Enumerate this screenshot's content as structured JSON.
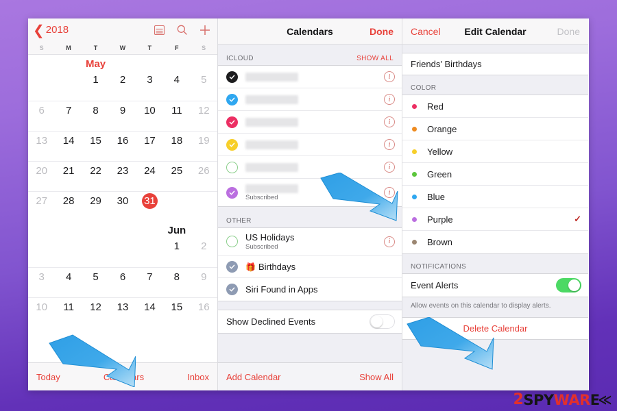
{
  "watermark": {
    "part1": "2",
    "part2": "SPY",
    "part3": "WAR",
    "part4": "E",
    "chevron": "≪"
  },
  "calendar_panel": {
    "back_label": "2018",
    "back_icon": "chevron-left-icon",
    "tools": [
      "list-view-icon",
      "search-icon",
      "add-icon"
    ],
    "weekdays": [
      "S",
      "M",
      "T",
      "W",
      "T",
      "F",
      "S"
    ],
    "months": [
      {
        "name": "May",
        "is_current": true,
        "weeks": [
          [
            {
              "num": "",
              "dot": false,
              "weekend": false,
              "today": false
            },
            {
              "num": "",
              "dot": false,
              "weekend": false,
              "today": false
            },
            {
              "num": "1",
              "dot": true,
              "weekend": false,
              "today": false
            },
            {
              "num": "2",
              "dot": true,
              "weekend": false,
              "today": false
            },
            {
              "num": "3",
              "dot": true,
              "weekend": false,
              "today": false
            },
            {
              "num": "4",
              "dot": true,
              "weekend": false,
              "today": false
            },
            {
              "num": "5",
              "dot": true,
              "weekend": true,
              "today": false
            }
          ],
          [
            {
              "num": "6",
              "dot": true,
              "weekend": true,
              "today": false
            },
            {
              "num": "7",
              "dot": true,
              "weekend": false,
              "today": false
            },
            {
              "num": "8",
              "dot": true,
              "weekend": false,
              "today": false
            },
            {
              "num": "9",
              "dot": true,
              "weekend": false,
              "today": false
            },
            {
              "num": "10",
              "dot": true,
              "weekend": false,
              "today": false
            },
            {
              "num": "11",
              "dot": true,
              "weekend": false,
              "today": false
            },
            {
              "num": "12",
              "dot": true,
              "weekend": true,
              "today": false
            }
          ],
          [
            {
              "num": "13",
              "dot": true,
              "weekend": true,
              "today": false
            },
            {
              "num": "14",
              "dot": true,
              "weekend": false,
              "today": false
            },
            {
              "num": "15",
              "dot": true,
              "weekend": false,
              "today": false
            },
            {
              "num": "16",
              "dot": true,
              "weekend": false,
              "today": false
            },
            {
              "num": "17",
              "dot": true,
              "weekend": false,
              "today": false
            },
            {
              "num": "18",
              "dot": true,
              "weekend": false,
              "today": false
            },
            {
              "num": "19",
              "dot": true,
              "weekend": true,
              "today": false
            }
          ],
          [
            {
              "num": "20",
              "dot": true,
              "weekend": true,
              "today": false
            },
            {
              "num": "21",
              "dot": true,
              "weekend": false,
              "today": false
            },
            {
              "num": "22",
              "dot": true,
              "weekend": false,
              "today": false
            },
            {
              "num": "23",
              "dot": true,
              "weekend": false,
              "today": false
            },
            {
              "num": "24",
              "dot": true,
              "weekend": false,
              "today": false
            },
            {
              "num": "25",
              "dot": true,
              "weekend": false,
              "today": false
            },
            {
              "num": "26",
              "dot": true,
              "weekend": true,
              "today": false
            }
          ],
          [
            {
              "num": "27",
              "dot": true,
              "weekend": true,
              "today": false
            },
            {
              "num": "28",
              "dot": true,
              "weekend": false,
              "today": false
            },
            {
              "num": "29",
              "dot": true,
              "weekend": false,
              "today": false
            },
            {
              "num": "30",
              "dot": true,
              "weekend": false,
              "today": false
            },
            {
              "num": "31",
              "dot": false,
              "weekend": false,
              "today": true
            },
            {
              "num": "",
              "dot": false,
              "weekend": false,
              "today": false
            },
            {
              "num": "",
              "dot": false,
              "weekend": true,
              "today": false
            }
          ]
        ]
      },
      {
        "name": "Jun",
        "is_current": false,
        "weeks": [
          [
            {
              "num": "",
              "dot": false,
              "weekend": false,
              "today": false
            },
            {
              "num": "",
              "dot": false,
              "weekend": false,
              "today": false
            },
            {
              "num": "",
              "dot": false,
              "weekend": false,
              "today": false
            },
            {
              "num": "",
              "dot": false,
              "weekend": false,
              "today": false
            },
            {
              "num": "",
              "dot": false,
              "weekend": false,
              "today": false
            },
            {
              "num": "1",
              "dot": true,
              "weekend": false,
              "today": false
            },
            {
              "num": "2",
              "dot": false,
              "weekend": true,
              "today": false
            }
          ],
          [
            {
              "num": "3",
              "dot": false,
              "weekend": true,
              "today": false
            },
            {
              "num": "4",
              "dot": false,
              "weekend": false,
              "today": false
            },
            {
              "num": "5",
              "dot": true,
              "weekend": false,
              "today": false
            },
            {
              "num": "6",
              "dot": false,
              "weekend": false,
              "today": false
            },
            {
              "num": "7",
              "dot": false,
              "weekend": false,
              "today": false
            },
            {
              "num": "8",
              "dot": true,
              "weekend": false,
              "today": false
            },
            {
              "num": "9",
              "dot": true,
              "weekend": true,
              "today": false
            }
          ],
          [
            {
              "num": "10",
              "dot": false,
              "weekend": true,
              "today": false
            },
            {
              "num": "11",
              "dot": false,
              "weekend": false,
              "today": false
            },
            {
              "num": "12",
              "dot": false,
              "weekend": false,
              "today": false
            },
            {
              "num": "13",
              "dot": false,
              "weekend": false,
              "today": false
            },
            {
              "num": "14",
              "dot": true,
              "weekend": false,
              "today": false
            },
            {
              "num": "15",
              "dot": false,
              "weekend": false,
              "today": false
            },
            {
              "num": "16",
              "dot": true,
              "weekend": true,
              "today": false
            }
          ]
        ]
      }
    ],
    "tabbar": {
      "left": "Today",
      "center": "Calendars",
      "right": "Inbox"
    }
  },
  "calendars_panel": {
    "nav": {
      "title": "Calendars",
      "right_action": "Done"
    },
    "icloud_section": {
      "title": "ICLOUD",
      "action": "SHOW ALL"
    },
    "icloud_rows": [
      {
        "color": "#1c1c1e",
        "checked": true,
        "redacted": true,
        "redact_width": "38%",
        "label": "",
        "sub": "",
        "info": true
      },
      {
        "color": "#2fa7f0",
        "checked": true,
        "redacted": true,
        "redact_width": "38%",
        "label": "",
        "sub": "",
        "info": true
      },
      {
        "color": "#ec2f63",
        "checked": true,
        "redacted": true,
        "redact_width": "38%",
        "label": "",
        "sub": "",
        "info": true
      },
      {
        "color": "#f7cf2a",
        "checked": true,
        "redacted": true,
        "redact_width": "38%",
        "label": "",
        "sub": "",
        "info": true
      },
      {
        "color": "#8ccf8c",
        "checked": false,
        "redacted": true,
        "redact_width": "38%",
        "label": "",
        "sub": "",
        "info": true
      },
      {
        "color": "#bb6fe0",
        "checked": true,
        "redacted": true,
        "redact_width": "38%",
        "label": "",
        "sub": "Subscribed",
        "info": true
      }
    ],
    "other_section": {
      "title": "OTHER"
    },
    "other_rows": [
      {
        "color": "#8ccf8c",
        "checked": false,
        "label": "US Holidays",
        "sub": "Subscribed",
        "info": true,
        "gift": false
      },
      {
        "color": "#8e9bb3",
        "checked": true,
        "label": "Birthdays",
        "sub": "",
        "info": false,
        "gift": true
      },
      {
        "color": "#8e9bb3",
        "checked": true,
        "label": "Siri Found in Apps",
        "sub": "",
        "info": false,
        "gift": false
      }
    ],
    "declined": {
      "label": "Show Declined Events",
      "state": "off"
    },
    "bottom": {
      "left": "Add Calendar",
      "right": "Show All"
    }
  },
  "edit_panel": {
    "nav": {
      "left_action": "Cancel",
      "title": "Edit Calendar",
      "right_action": "Done"
    },
    "calendar_name": "Friends' Birthdays",
    "color_section": {
      "title": "COLOR"
    },
    "colors": [
      {
        "name": "Red",
        "hex": "#ec2f63",
        "selected": false
      },
      {
        "name": "Orange",
        "hex": "#ee8b20",
        "selected": false
      },
      {
        "name": "Yellow",
        "hex": "#f7cf2a",
        "selected": false
      },
      {
        "name": "Green",
        "hex": "#5cc63c",
        "selected": false
      },
      {
        "name": "Blue",
        "hex": "#2fa7f0",
        "selected": false
      },
      {
        "name": "Purple",
        "hex": "#bb6fe0",
        "selected": true
      },
      {
        "name": "Brown",
        "hex": "#9b8671",
        "selected": false
      }
    ],
    "selected_mark": "✓",
    "notifications_section": {
      "title": "NOTIFICATIONS"
    },
    "event_alerts": {
      "label": "Event Alerts",
      "state": "on"
    },
    "footnote": "Allow events on this calendar to display alerts.",
    "delete_label": "Delete Calendar"
  },
  "annotations": {
    "arrows": [
      {
        "name": "arrow-calendars-tab",
        "points_to": "Calendars"
      },
      {
        "name": "arrow-info-button",
        "points_to": "info button"
      },
      {
        "name": "arrow-delete",
        "points_to": "Delete Calendar"
      }
    ],
    "color": "#2b9fe8"
  }
}
